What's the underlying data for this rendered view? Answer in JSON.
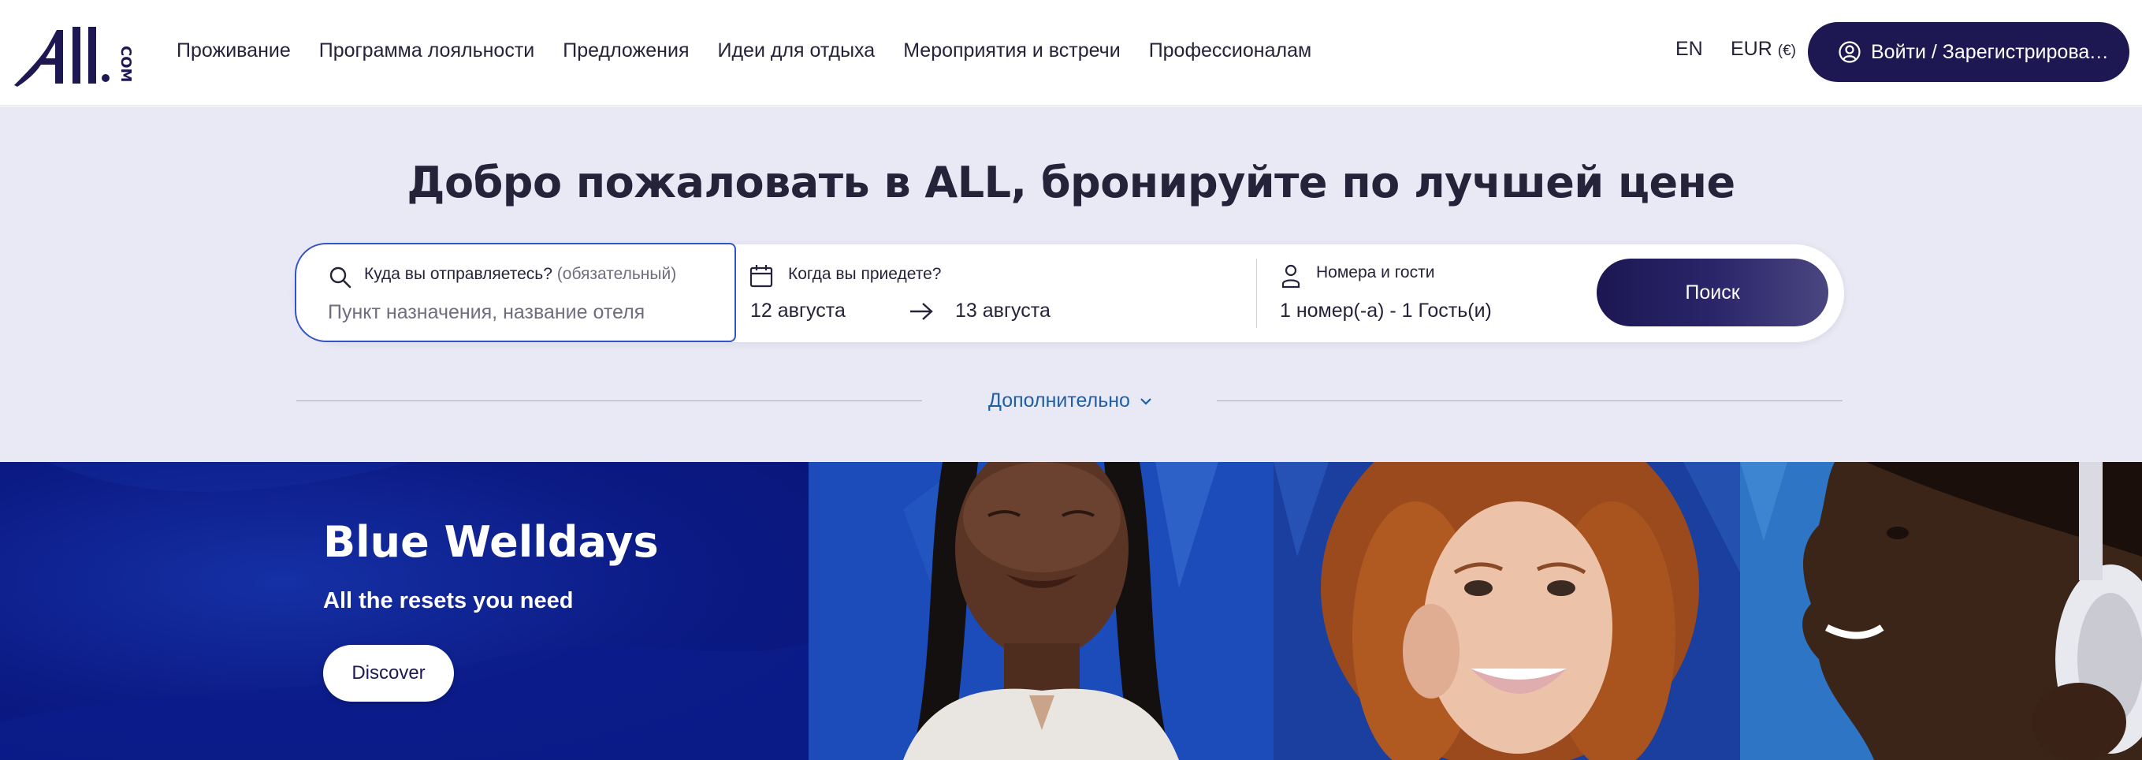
{
  "header": {
    "logo_text": "ALL.COM",
    "nav": [
      {
        "label": "Проживание"
      },
      {
        "label": "Программа лояльности"
      },
      {
        "label": "Предложения"
      },
      {
        "label": "Идеи для отдыха"
      },
      {
        "label": "Мероприятия и встречи"
      },
      {
        "label": "Профессионалам"
      }
    ],
    "language": "EN",
    "currency": "EUR",
    "currency_symbol": "(€)",
    "login_label": "Войти / Зарегистрироваться",
    "login_icon": "user-circle-icon"
  },
  "search": {
    "title": "Добро пожаловать в ALL, бронируйте по лучшей цене",
    "destination": {
      "label": "Куда вы отправляетесь?",
      "optional": "(обязательный)",
      "placeholder": "Пункт назначения, название отеля",
      "icon": "search-icon"
    },
    "dates": {
      "label": "Когда вы приедете?",
      "checkin": "12 августа",
      "checkout": "13 августа",
      "icon": "calendar-icon"
    },
    "guests": {
      "label": "Номера и гости",
      "value": "1 номер(-а) - 1 Гость(и)",
      "icon": "person-icon"
    },
    "submit_label": "Поиск",
    "more_label": "Дополнительно"
  },
  "promo": {
    "title": "Blue Welldays",
    "subtitle": "All the resets you need",
    "cta": "Discover"
  },
  "colors": {
    "brand_navy": "#1e1852",
    "focus_blue": "#3553c7",
    "link_blue": "#1f5fa8",
    "band_bg": "#e8e9f4",
    "promo_blue": "#0d1c86"
  }
}
